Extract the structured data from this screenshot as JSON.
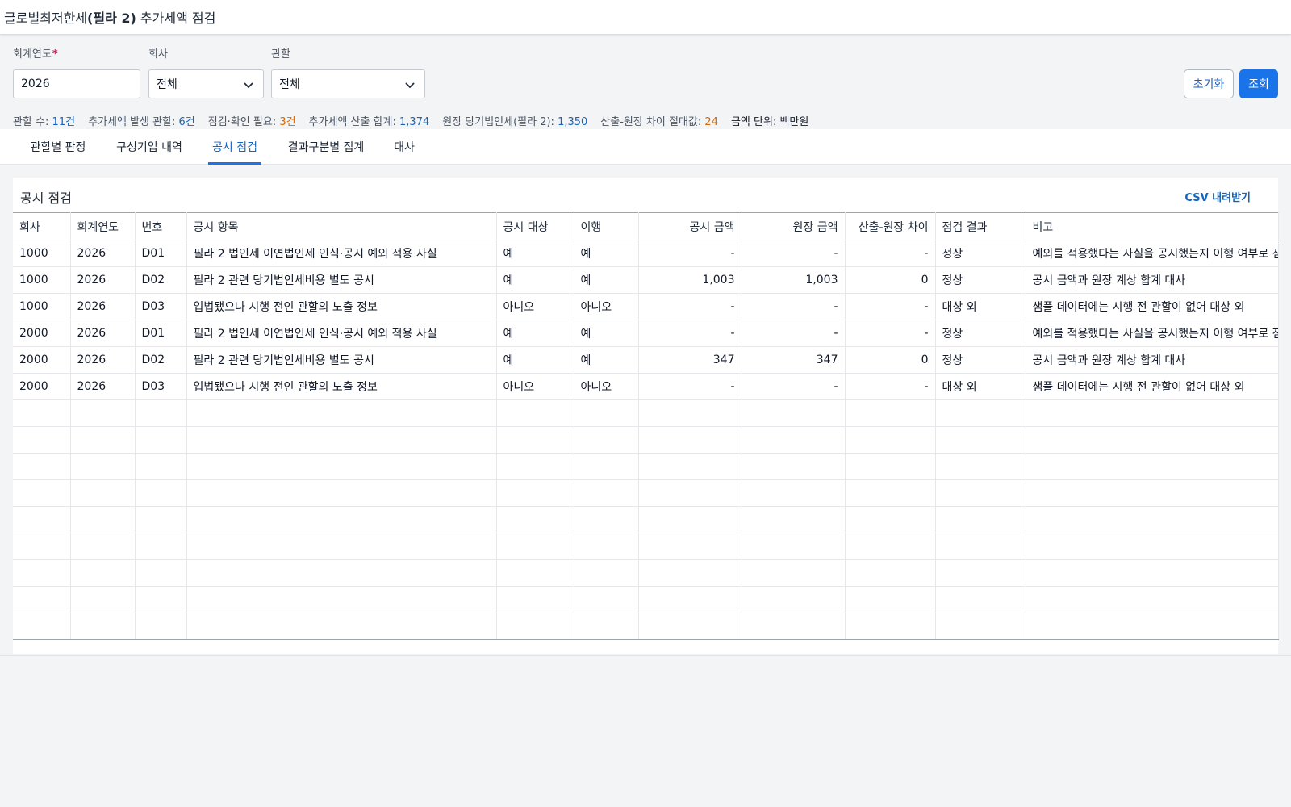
{
  "header": {
    "title_prefix": "글로벌최저한세",
    "title_bold": "(필라 2)",
    "title_suffix": " 추가세액 점검"
  },
  "filters": {
    "year": {
      "label": "회계연도",
      "required_mark": "*",
      "value": "2026"
    },
    "company": {
      "label": "회사",
      "value": "전체"
    },
    "jurisdiction": {
      "label": "관할",
      "value": "전체"
    }
  },
  "actions": {
    "reset_label": "초기화",
    "search_label": "조회"
  },
  "summary": {
    "jurisdiction_count_label": "관할 수:",
    "jurisdiction_count": "11건",
    "topup_jurisdictions_label": "추가세액 발생 관할:",
    "topup_jurisdictions": "6건",
    "review_needed_label": "점검·확인 필요:",
    "review_needed": "3건",
    "topup_total_label": "추가세액 산출 합계:",
    "topup_total": "1,374",
    "ledger_tax_label": "원장 당기법인세(필라 2):",
    "ledger_tax": "1,350",
    "diff_label": "산출-원장 차이 절대값:",
    "diff": "24",
    "unit_label": "금액 단위:",
    "unit": "백만원"
  },
  "tabs": [
    {
      "label": "관할별 판정"
    },
    {
      "label": "구성기업 내역"
    },
    {
      "label": "공시 점검"
    },
    {
      "label": "결과구분별 집계"
    },
    {
      "label": "대사"
    }
  ],
  "panel": {
    "title": "공시 점검",
    "csv_label": "CSV 내려받기"
  },
  "table": {
    "columns": [
      "회사",
      "회계연도",
      "번호",
      "공시 항목",
      "공시 대상",
      "이행",
      "공시 금액",
      "원장 금액",
      "산출-원장 차이",
      "점검 결과",
      "비고"
    ],
    "rows": [
      [
        "1000",
        "2026",
        "D01",
        "필라 2 법인세 이연법인세 인식·공시 예외 적용 사실",
        "예",
        "예",
        "-",
        "-",
        "-",
        "정상",
        "예외를 적용했다는 사실을 공시했는지 이행 여부로 점검"
      ],
      [
        "1000",
        "2026",
        "D02",
        "필라 2 관련 당기법인세비용 별도 공시",
        "예",
        "예",
        "1,003",
        "1,003",
        "0",
        "정상",
        "공시 금액과 원장 계상 합계 대사"
      ],
      [
        "1000",
        "2026",
        "D03",
        "입법됐으나 시행 전인 관할의 노출 정보",
        "아니오",
        "아니오",
        "-",
        "-",
        "-",
        "대상 외",
        "샘플 데이터에는 시행 전 관할이 없어 대상 외"
      ],
      [
        "2000",
        "2026",
        "D01",
        "필라 2 법인세 이연법인세 인식·공시 예외 적용 사실",
        "예",
        "예",
        "-",
        "-",
        "-",
        "정상",
        "예외를 적용했다는 사실을 공시했는지 이행 여부로 점검"
      ],
      [
        "2000",
        "2026",
        "D02",
        "필라 2 관련 당기법인세비용 별도 공시",
        "예",
        "예",
        "347",
        "347",
        "0",
        "정상",
        "공시 금액과 원장 계상 합계 대사"
      ],
      [
        "2000",
        "2026",
        "D03",
        "입법됐으나 시행 전인 관할의 노출 정보",
        "아니오",
        "아니오",
        "-",
        "-",
        "-",
        "대상 외",
        "샘플 데이터에는 시행 전 관할이 없어 대상 외"
      ]
    ],
    "empty_rows": 9
  },
  "colors": {
    "accent": "#1a73e8",
    "link": "#1565c0",
    "ok": "#2e7d32",
    "warn": "#d46b08"
  }
}
